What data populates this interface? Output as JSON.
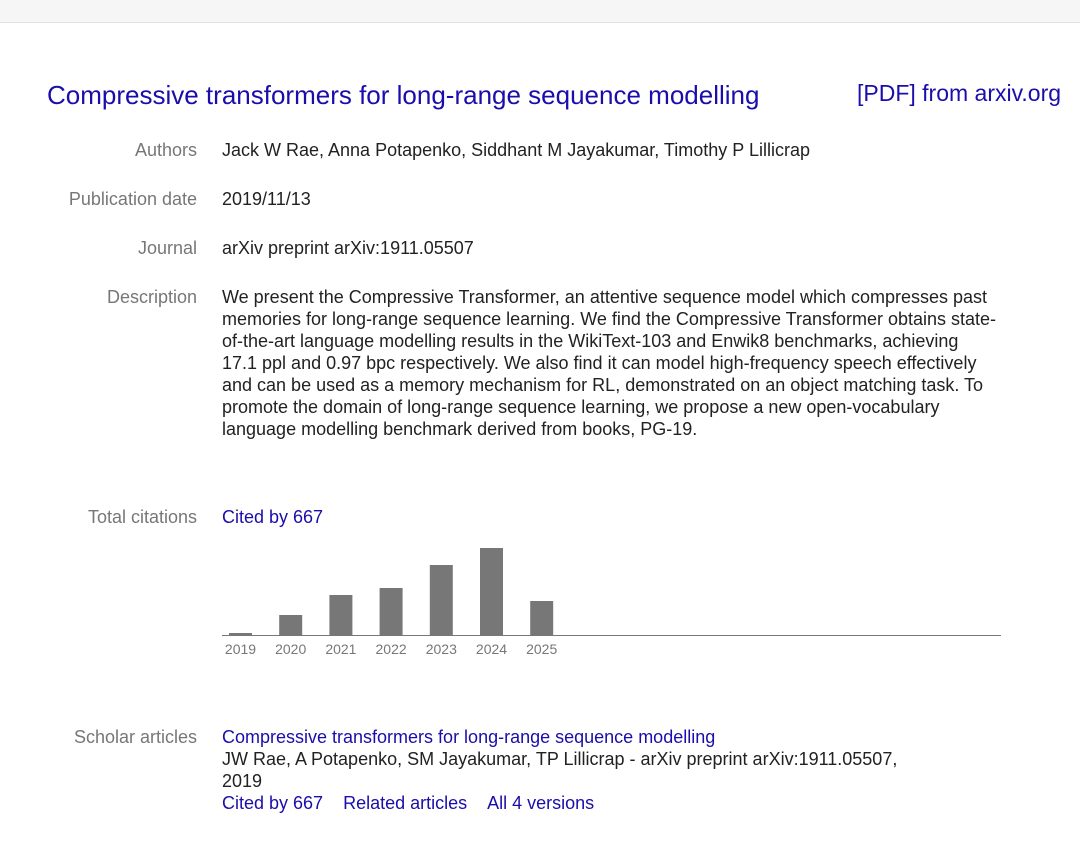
{
  "header": {
    "title": "Compressive transformers for long-range sequence modelling",
    "pdf_link": "[PDF] from arxiv.org"
  },
  "fields": {
    "authors_label": "Authors",
    "authors": "Jack W Rae, Anna Potapenko, Siddhant M Jayakumar, Timothy P Lillicrap",
    "date_label": "Publication date",
    "date": "2019/11/13",
    "journal_label": "Journal",
    "journal": "arXiv preprint arXiv:1911.05507",
    "description_label": "Description",
    "description": "We present the Compressive Transformer, an attentive sequence model which compresses past memories for long-range sequence learning. We find the Compressive Transformer obtains state-of-the-art language modelling results in the WikiText-103 and Enwik8 benchmarks, achieving 17.1 ppl and 0.97 bpc respectively. We also find it can model high-frequency speech effectively and can be used as a memory mechanism for RL, demonstrated on an object matching task. To promote the domain of long-range sequence learning, we propose a new open-vocabulary language modelling benchmark derived from books, PG-19.",
    "citations_label": "Total citations",
    "cited_by": "Cited by 667"
  },
  "chart_data": {
    "type": "bar",
    "categories": [
      "2019",
      "2020",
      "2021",
      "2022",
      "2023",
      "2024",
      "2025"
    ],
    "values": [
      2,
      20,
      40,
      47,
      70,
      87,
      34
    ],
    "ylim": [
      0,
      87
    ],
    "bar_color": "#777777",
    "title": "",
    "xlabel": "",
    "ylabel": ""
  },
  "scholar": {
    "label": "Scholar articles",
    "article_title": "Compressive transformers for long-range sequence modelling",
    "meta_line1": "JW Rae, A Potapenko, SM Jayakumar, TP Lillicrap - arXiv preprint arXiv:1911.05507,",
    "meta_line2": "2019",
    "cited_by": "Cited by 667",
    "related": "Related articles",
    "versions": "All 4 versions"
  },
  "colors": {
    "link": "#1a0dab",
    "label": "#777777",
    "text": "#222222"
  }
}
